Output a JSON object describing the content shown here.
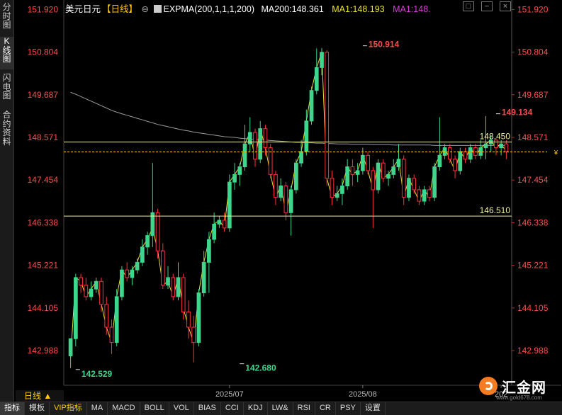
{
  "sidebar": {
    "tabs": [
      {
        "label": "分时图",
        "active": false
      },
      {
        "label": "K线图",
        "active": true
      },
      {
        "label": "闪电图",
        "active": false
      },
      {
        "label": "合约资料",
        "active": false
      }
    ]
  },
  "info_bar": {
    "symbol": "美元日元",
    "period_tag": "【日线】",
    "expma": "EXPMA(200,1,1,1,200)",
    "ma200": "MA200:148.361",
    "ma1": "MA1:148.193",
    "ma1_clipped": "MA1:148."
  },
  "colors": {
    "up": "#3dd68c",
    "down": "#ff3040",
    "ma200": "#9a9a9a",
    "ma1": "#e8e030",
    "price_label": "#ff4b4b",
    "hline": "#f0f0a0"
  },
  "period_label": "日线 ▲",
  "bottom_tabs": [
    "指标",
    "模板",
    "VIP指标",
    "MA",
    "MACD",
    "BOLL",
    "VOL",
    "BIAS",
    "CCI",
    "KDJ",
    "LW&",
    "RSI",
    "CR",
    "PSY",
    "设置"
  ],
  "brand": {
    "name": "汇金网",
    "url": "www.gold678.com"
  },
  "chart_data": {
    "type": "candlestick",
    "y_ticks": [
      "151.920",
      "150.804",
      "149.687",
      "148.571",
      "147.454",
      "146.338",
      "145.221",
      "144.105",
      "142.988"
    ],
    "ylim": [
      142.08,
      152.02
    ],
    "x_labels": [
      {
        "label": "2025/07",
        "index": 31
      },
      {
        "label": "2025/08",
        "index": 57
      },
      {
        "label": "202",
        "index": 84
      }
    ],
    "annotations": [
      {
        "text": "150.914",
        "index": 57,
        "value": 150.914,
        "type": "high"
      },
      {
        "text": "142.529",
        "index": 1,
        "value": 142.529,
        "type": "low"
      },
      {
        "text": "142.680",
        "index": 33,
        "value": 142.68,
        "type": "low"
      },
      {
        "text": "149.134",
        "index": 83,
        "value": 149.134,
        "type": "high"
      }
    ],
    "hlines": [
      {
        "value": 148.45,
        "label": "148.450"
      },
      {
        "value": 146.51,
        "label": "146.510"
      }
    ],
    "current_price": 148.19,
    "ma200": [
      149.75,
      149.7,
      149.64,
      149.58,
      149.52,
      149.46,
      149.4,
      149.34,
      149.28,
      149.23,
      149.19,
      149.15,
      149.11,
      149.07,
      149.03,
      148.99,
      148.95,
      148.91,
      148.88,
      148.85,
      148.82,
      148.79,
      148.76,
      148.74,
      148.71,
      148.69,
      148.67,
      148.65,
      148.63,
      148.61,
      148.59,
      148.58,
      148.57,
      148.55,
      148.54,
      148.53,
      148.52,
      148.51,
      148.5,
      148.49,
      148.48,
      148.47,
      148.46,
      148.45,
      148.44,
      148.44,
      148.43,
      148.43,
      148.42,
      148.42,
      148.41,
      148.41,
      148.4,
      148.4,
      148.4,
      148.39,
      148.39,
      148.39,
      148.39,
      148.38,
      148.38,
      148.38,
      148.38,
      148.37,
      148.37,
      148.37,
      148.37,
      148.37,
      148.37,
      148.37,
      148.37,
      148.36,
      148.36,
      148.36,
      148.36,
      148.36,
      148.36,
      148.36,
      148.36,
      148.36,
      148.36,
      148.36,
      148.36,
      148.36,
      148.36,
      148.36
    ],
    "ma1": [
      142.8,
      144.9,
      144.8,
      144.4,
      144.6,
      144.8,
      144.2,
      143.6,
      143.2,
      144.4,
      145.1,
      144.9,
      145.1,
      145.3,
      145.7,
      145.9,
      146.2,
      145.6,
      144.7,
      144.8,
      144.4,
      144.9,
      144.1,
      143.6,
      143.2,
      144.5,
      145.3,
      145.9,
      146.3,
      146.4,
      146.2,
      147.4,
      147.6,
      147.8,
      148.4,
      148.7,
      148.0,
      148.8,
      148.3,
      147.6,
      147.0,
      147.3,
      146.6,
      147.2,
      147.9,
      148.2,
      149.0,
      149.8,
      150.4,
      150.8,
      147.5,
      147.0,
      147.1,
      147.3,
      147.8,
      147.6,
      147.7,
      148.1,
      147.7,
      147.2,
      147.9,
      147.5,
      147.6,
      147.8,
      148.0,
      147.0,
      147.5,
      147.2,
      146.9,
      147.2,
      147.0,
      147.8,
      148.1,
      148.3,
      148.0,
      147.7,
      148.2,
      148.0,
      148.3,
      148.1,
      148.3,
      148.4,
      148.5,
      148.3,
      148.4,
      148.2
    ],
    "candles": [
      {
        "o": 142.85,
        "h": 143.3,
        "l": 142.53,
        "c": 143.3
      },
      {
        "o": 143.3,
        "h": 145.0,
        "l": 143.1,
        "c": 144.9
      },
      {
        "o": 144.9,
        "h": 145.0,
        "l": 144.5,
        "c": 144.7
      },
      {
        "o": 144.7,
        "h": 144.9,
        "l": 144.3,
        "c": 144.4
      },
      {
        "o": 144.4,
        "h": 144.8,
        "l": 144.3,
        "c": 144.6
      },
      {
        "o": 144.6,
        "h": 144.9,
        "l": 144.5,
        "c": 144.8
      },
      {
        "o": 144.8,
        "h": 144.9,
        "l": 144.0,
        "c": 144.2
      },
      {
        "o": 144.2,
        "h": 144.4,
        "l": 143.4,
        "c": 143.6
      },
      {
        "o": 143.6,
        "h": 143.8,
        "l": 142.9,
        "c": 143.2
      },
      {
        "o": 143.2,
        "h": 144.6,
        "l": 143.1,
        "c": 144.4
      },
      {
        "o": 144.4,
        "h": 145.2,
        "l": 144.3,
        "c": 145.1
      },
      {
        "o": 145.1,
        "h": 145.3,
        "l": 144.8,
        "c": 144.9
      },
      {
        "o": 144.9,
        "h": 145.2,
        "l": 144.7,
        "c": 145.1
      },
      {
        "o": 145.1,
        "h": 145.4,
        "l": 145.0,
        "c": 145.3
      },
      {
        "o": 145.3,
        "h": 145.9,
        "l": 145.2,
        "c": 145.7
      },
      {
        "o": 145.7,
        "h": 146.1,
        "l": 145.5,
        "c": 146.0
      },
      {
        "o": 146.0,
        "h": 147.9,
        "l": 145.7,
        "c": 146.6
      },
      {
        "o": 146.6,
        "h": 146.7,
        "l": 145.4,
        "c": 145.6
      },
      {
        "o": 145.6,
        "h": 145.8,
        "l": 144.6,
        "c": 144.7
      },
      {
        "o": 144.7,
        "h": 145.2,
        "l": 144.6,
        "c": 144.9
      },
      {
        "o": 144.9,
        "h": 145.0,
        "l": 144.3,
        "c": 144.4
      },
      {
        "o": 144.4,
        "h": 145.3,
        "l": 144.3,
        "c": 144.9
      },
      {
        "o": 144.9,
        "h": 145.0,
        "l": 143.8,
        "c": 144.0
      },
      {
        "o": 144.0,
        "h": 144.3,
        "l": 143.3,
        "c": 143.6
      },
      {
        "o": 143.6,
        "h": 143.9,
        "l": 142.68,
        "c": 143.2
      },
      {
        "o": 143.2,
        "h": 144.6,
        "l": 143.1,
        "c": 144.5
      },
      {
        "o": 144.5,
        "h": 145.6,
        "l": 144.4,
        "c": 145.3
      },
      {
        "o": 145.3,
        "h": 146.1,
        "l": 144.5,
        "c": 145.9
      },
      {
        "o": 145.9,
        "h": 146.6,
        "l": 145.8,
        "c": 146.3
      },
      {
        "o": 146.3,
        "h": 146.5,
        "l": 146.2,
        "c": 146.4
      },
      {
        "o": 146.4,
        "h": 146.6,
        "l": 146.1,
        "c": 146.2
      },
      {
        "o": 146.2,
        "h": 147.6,
        "l": 146.1,
        "c": 147.4
      },
      {
        "o": 147.4,
        "h": 147.9,
        "l": 147.2,
        "c": 147.6
      },
      {
        "o": 147.6,
        "h": 147.9,
        "l": 147.3,
        "c": 147.8
      },
      {
        "o": 147.8,
        "h": 148.9,
        "l": 147.7,
        "c": 148.4
      },
      {
        "o": 148.4,
        "h": 149.1,
        "l": 148.2,
        "c": 148.7
      },
      {
        "o": 148.7,
        "h": 148.8,
        "l": 147.8,
        "c": 148.0
      },
      {
        "o": 148.0,
        "h": 149.0,
        "l": 147.9,
        "c": 148.8
      },
      {
        "o": 148.8,
        "h": 148.9,
        "l": 148.1,
        "c": 148.3
      },
      {
        "o": 148.3,
        "h": 148.4,
        "l": 147.5,
        "c": 147.6
      },
      {
        "o": 147.6,
        "h": 147.7,
        "l": 146.8,
        "c": 147.0
      },
      {
        "o": 147.0,
        "h": 147.5,
        "l": 146.9,
        "c": 147.3
      },
      {
        "o": 147.3,
        "h": 147.4,
        "l": 146.4,
        "c": 146.6
      },
      {
        "o": 146.6,
        "h": 147.3,
        "l": 146.0,
        "c": 147.2
      },
      {
        "o": 147.2,
        "h": 148.0,
        "l": 147.1,
        "c": 147.9
      },
      {
        "o": 147.9,
        "h": 148.5,
        "l": 147.8,
        "c": 148.2
      },
      {
        "o": 148.2,
        "h": 149.3,
        "l": 148.1,
        "c": 149.0
      },
      {
        "o": 149.0,
        "h": 149.9,
        "l": 148.9,
        "c": 149.8
      },
      {
        "o": 149.8,
        "h": 150.9,
        "l": 149.7,
        "c": 150.4
      },
      {
        "o": 150.4,
        "h": 150.91,
        "l": 150.2,
        "c": 150.8
      },
      {
        "o": 150.8,
        "h": 150.85,
        "l": 147.3,
        "c": 147.5
      },
      {
        "o": 147.5,
        "h": 147.7,
        "l": 146.8,
        "c": 147.0
      },
      {
        "o": 147.0,
        "h": 147.3,
        "l": 146.9,
        "c": 147.1
      },
      {
        "o": 147.1,
        "h": 147.5,
        "l": 146.8,
        "c": 147.3
      },
      {
        "o": 147.3,
        "h": 148.0,
        "l": 147.2,
        "c": 147.8
      },
      {
        "o": 147.8,
        "h": 148.0,
        "l": 147.3,
        "c": 147.6
      },
      {
        "o": 147.6,
        "h": 147.9,
        "l": 147.4,
        "c": 147.7
      },
      {
        "o": 147.7,
        "h": 148.3,
        "l": 147.6,
        "c": 148.1
      },
      {
        "o": 148.1,
        "h": 148.2,
        "l": 147.6,
        "c": 147.7
      },
      {
        "o": 147.7,
        "h": 147.8,
        "l": 146.2,
        "c": 147.2
      },
      {
        "o": 147.2,
        "h": 148.0,
        "l": 147.1,
        "c": 147.9
      },
      {
        "o": 147.9,
        "h": 148.0,
        "l": 147.4,
        "c": 147.5
      },
      {
        "o": 147.5,
        "h": 147.7,
        "l": 147.3,
        "c": 147.6
      },
      {
        "o": 147.6,
        "h": 148.0,
        "l": 147.5,
        "c": 147.8
      },
      {
        "o": 147.8,
        "h": 148.4,
        "l": 147.7,
        "c": 148.0
      },
      {
        "o": 148.0,
        "h": 148.1,
        "l": 146.8,
        "c": 147.0
      },
      {
        "o": 147.0,
        "h": 147.6,
        "l": 146.9,
        "c": 147.5
      },
      {
        "o": 147.5,
        "h": 147.6,
        "l": 147.1,
        "c": 147.2
      },
      {
        "o": 147.2,
        "h": 147.3,
        "l": 146.8,
        "c": 146.9
      },
      {
        "o": 146.9,
        "h": 147.3,
        "l": 146.8,
        "c": 147.2
      },
      {
        "o": 147.2,
        "h": 147.3,
        "l": 146.9,
        "c": 147.0
      },
      {
        "o": 147.0,
        "h": 147.9,
        "l": 146.9,
        "c": 147.8
      },
      {
        "o": 147.8,
        "h": 149.1,
        "l": 147.7,
        "c": 148.1
      },
      {
        "o": 148.1,
        "h": 148.4,
        "l": 148.0,
        "c": 148.3
      },
      {
        "o": 148.3,
        "h": 148.4,
        "l": 147.9,
        "c": 148.0
      },
      {
        "o": 148.0,
        "h": 148.1,
        "l": 147.5,
        "c": 147.7
      },
      {
        "o": 147.7,
        "h": 148.3,
        "l": 147.6,
        "c": 148.2
      },
      {
        "o": 148.2,
        "h": 148.3,
        "l": 147.9,
        "c": 148.0
      },
      {
        "o": 148.0,
        "h": 148.4,
        "l": 147.9,
        "c": 148.3
      },
      {
        "o": 148.3,
        "h": 148.4,
        "l": 148.0,
        "c": 148.1
      },
      {
        "o": 148.1,
        "h": 148.5,
        "l": 148.0,
        "c": 148.3
      },
      {
        "o": 148.3,
        "h": 149.13,
        "l": 148.0,
        "c": 148.4
      },
      {
        "o": 148.4,
        "h": 148.6,
        "l": 148.2,
        "c": 148.5
      },
      {
        "o": 148.5,
        "h": 148.55,
        "l": 148.1,
        "c": 148.3
      },
      {
        "o": 148.3,
        "h": 148.5,
        "l": 148.1,
        "c": 148.4
      },
      {
        "o": 148.4,
        "h": 148.5,
        "l": 148.0,
        "c": 148.2
      }
    ]
  }
}
